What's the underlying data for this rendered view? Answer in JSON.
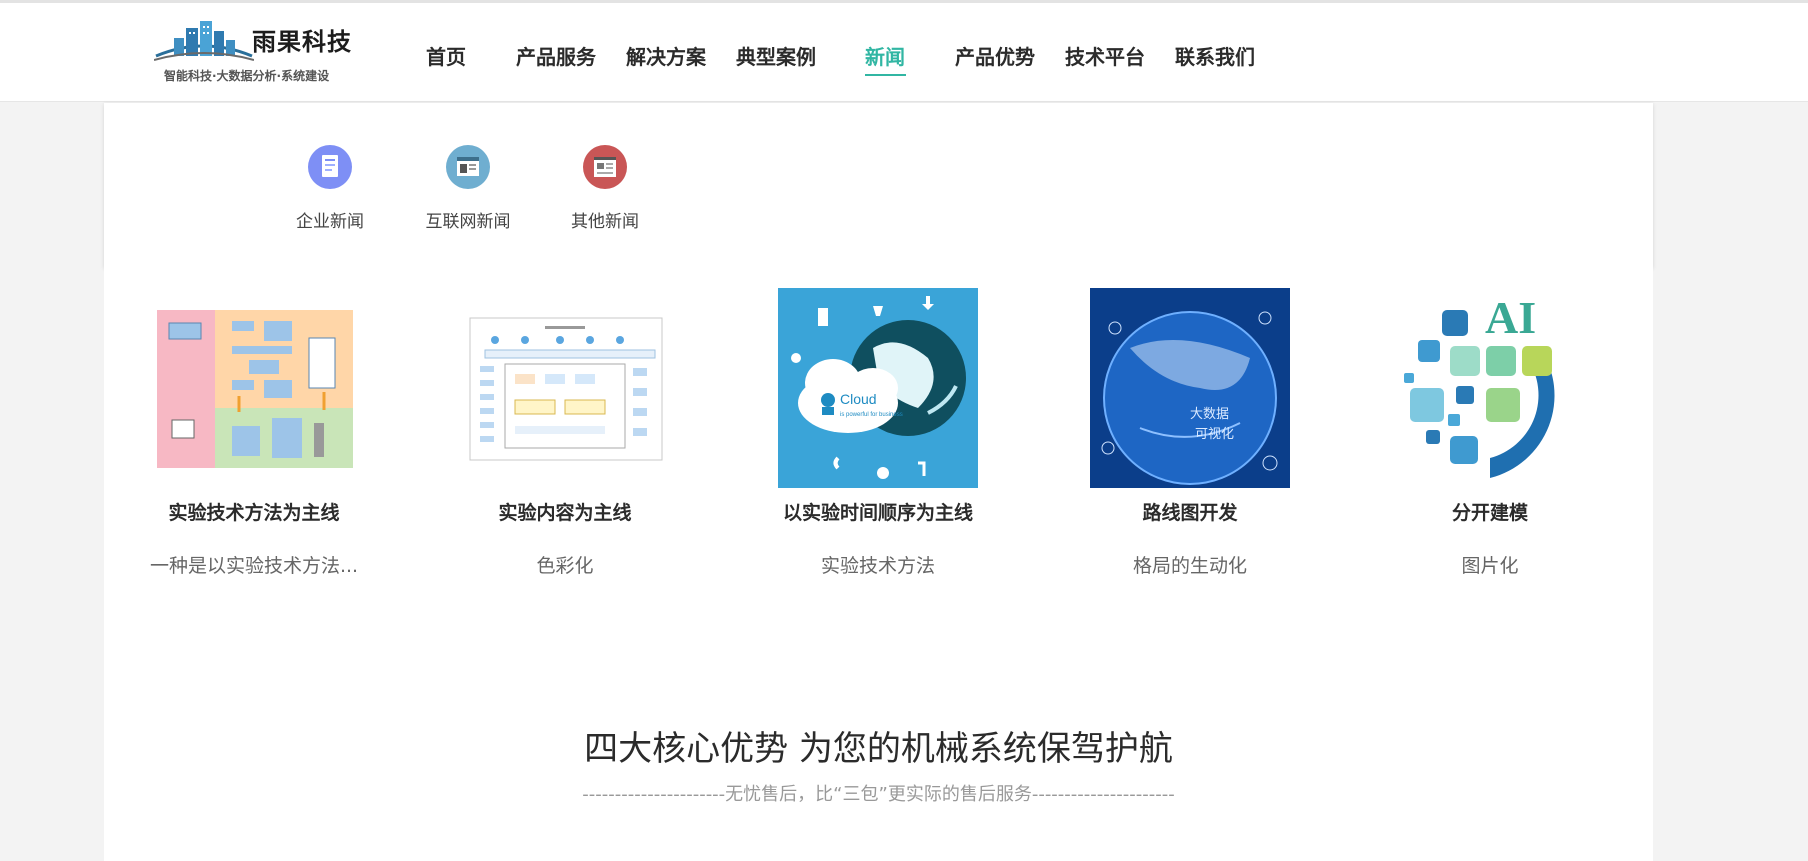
{
  "header": {
    "brand": "雨果科技",
    "slogan": "智能科技·大数据分析·系统建设"
  },
  "nav": {
    "items": [
      {
        "label": "首页"
      },
      {
        "label": "产品服务"
      },
      {
        "label": "解决方案"
      },
      {
        "label": "典型案例"
      },
      {
        "label": "新闻",
        "active": true
      },
      {
        "label": "产品优势"
      },
      {
        "label": "技术平台"
      },
      {
        "label": "联系我们"
      }
    ]
  },
  "categories": [
    {
      "label": "企业新闻",
      "icon": "document-icon",
      "color": "#7e8ff5"
    },
    {
      "label": "互联网新闻",
      "icon": "browser-window-icon",
      "color": "#6faed0"
    },
    {
      "label": "其他新闻",
      "icon": "newspaper-icon",
      "color": "#c95656"
    }
  ],
  "cards": [
    {
      "title": "实验技术方法为主线",
      "desc": "一种是以实验技术方法...",
      "image": "flowchart-diagram-image"
    },
    {
      "title": "实验内容为主线",
      "desc": "色彩化",
      "image": "system-diagram-image"
    },
    {
      "title": "以实验时间顺序为主线",
      "desc": "实验技术方法",
      "image": "cloud-globe-image"
    },
    {
      "title": "路线图开发",
      "desc": "格局的生动化",
      "image": "big-data-globe-image"
    },
    {
      "title": "分开建模",
      "desc": "图片化",
      "image": "ai-logo-image"
    }
  ],
  "images": {
    "cloud_text": "Cloud",
    "cloud_sub": "is powerful for business",
    "globe_text_1": "大数据",
    "globe_text_2": "可视化",
    "ai_text": "AI"
  },
  "advantages": {
    "title": "四大核心优势 为您的机械系统保驾护航",
    "subtitle": "----------------------无忧售后，比“三包”更实际的售后服务----------------------"
  },
  "colors": {
    "accent": "#31b6a3"
  }
}
